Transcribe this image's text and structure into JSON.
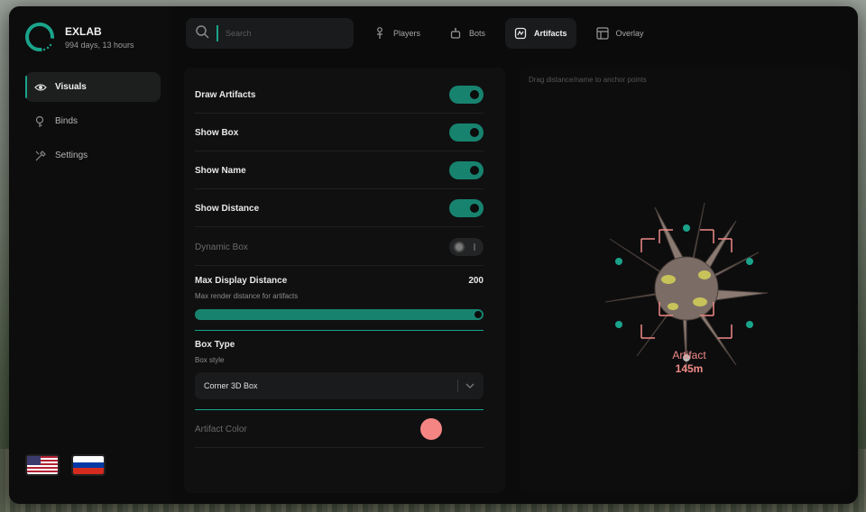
{
  "brand": {
    "name": "EXLAB",
    "subtitle": "994 days, 13 hours",
    "accent": "#1aa38b"
  },
  "sidebar": {
    "items": [
      {
        "label": "Visuals",
        "icon": "eye-icon",
        "active": true
      },
      {
        "label": "Binds",
        "icon": "keybind-icon",
        "active": false
      },
      {
        "label": "Settings",
        "icon": "settings-icon",
        "active": false
      }
    ],
    "languages": [
      "us-flag",
      "ru-flag"
    ]
  },
  "topbar": {
    "search_placeholder": "Search",
    "tabs": [
      {
        "label": "Players",
        "icon": "player-icon",
        "active": false
      },
      {
        "label": "Bots",
        "icon": "bot-icon",
        "active": false
      },
      {
        "label": "Artifacts",
        "icon": "artifact-icon",
        "active": true
      },
      {
        "label": "Overlay",
        "icon": "overlay-icon",
        "active": false
      }
    ]
  },
  "settings": {
    "draw_artifacts": {
      "label": "Draw Artifacts",
      "enabled": true
    },
    "show_box": {
      "label": "Show Box",
      "enabled": true
    },
    "show_name": {
      "label": "Show Name",
      "enabled": true
    },
    "show_distance": {
      "label": "Show Distance",
      "enabled": true
    },
    "dynamic_box": {
      "label": "Dynamic Box",
      "enabled": false
    },
    "max_distance": {
      "label": "Max Display Distance",
      "description": "Max render distance for artifacts",
      "value": "200",
      "fraction": 1.0
    },
    "box_type": {
      "label": "Box Type",
      "description": "Box style",
      "selected": "Corner 3D Box"
    },
    "artifact_color": {
      "label": "Artifact Color",
      "color": "#f58583"
    }
  },
  "preview": {
    "hint": "Drag distance/name to anchor points",
    "esp_name": "Artifact",
    "esp_distance": "145m",
    "box_color": "#f08a86"
  }
}
